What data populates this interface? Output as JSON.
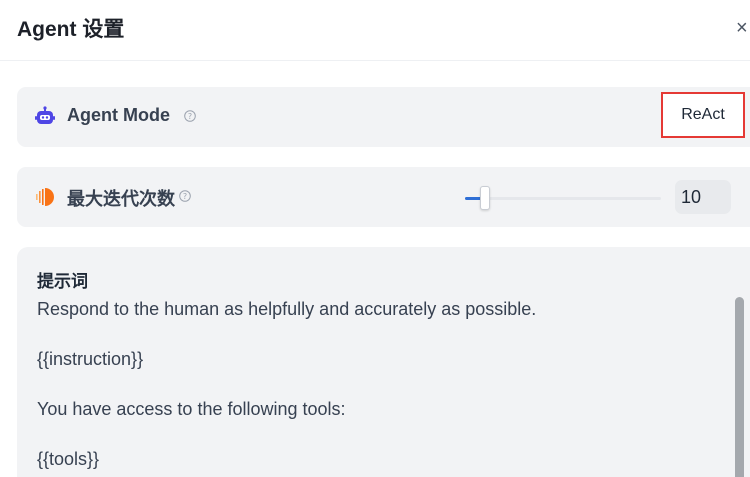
{
  "dialog": {
    "title": "Agent 设置",
    "close_label": "×"
  },
  "agent_mode": {
    "label": "Agent Mode",
    "value": "ReAct"
  },
  "iterations": {
    "label": "最大迭代次数",
    "value": "10",
    "slider_fraction": 0.1
  },
  "prompt": {
    "label": "提示词",
    "lines": [
      "Respond to the human as helpfully and accurately as possible.",
      "{{instruction}}",
      "You have access to the following tools:",
      "{{tools}}"
    ]
  },
  "colors": {
    "accent": "#2f6fd6",
    "highlight_border": "#e53935",
    "robot_icon": "#4f46e5",
    "iteration_icon": "#f97316"
  }
}
